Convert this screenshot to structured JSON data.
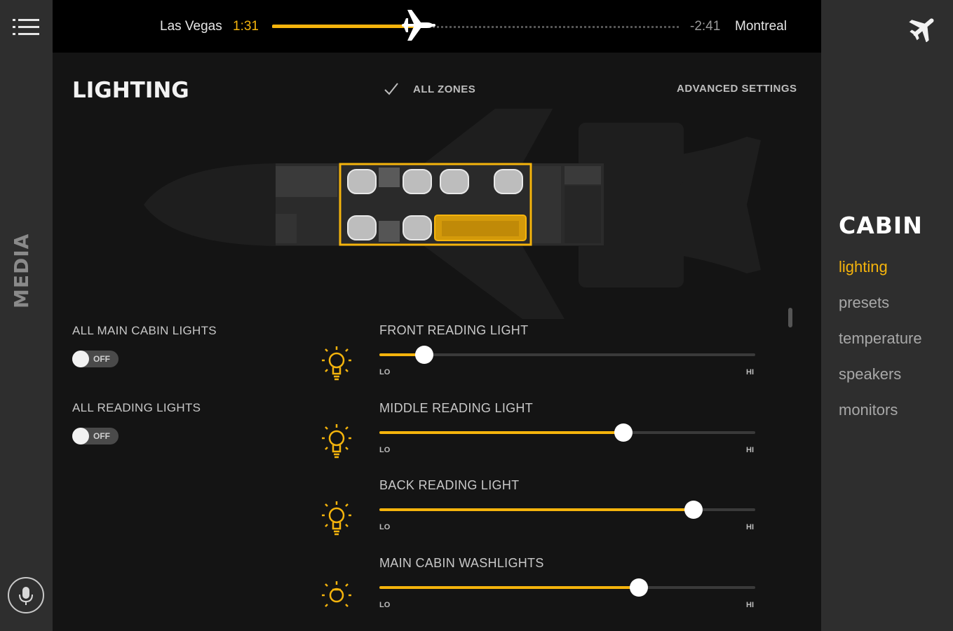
{
  "flight": {
    "origin": "Las Vegas",
    "elapsed": "1:31",
    "remaining": "-2:41",
    "destination": "Montreal",
    "progress": 0.36
  },
  "left_rail": {
    "menu_icon": "hamburger-menu-icon",
    "label": "MEDIA",
    "mic_icon": "microphone-icon"
  },
  "header": {
    "title": "LIGHTING",
    "all_zones_label": "ALL ZONES",
    "all_zones_checked": true,
    "advanced_label": "ADVANCED SETTINGS"
  },
  "toggles": [
    {
      "label": "ALL MAIN CABIN LIGHTS",
      "state": "OFF"
    },
    {
      "label": "ALL READING LIGHTS",
      "state": "OFF"
    }
  ],
  "sliders": [
    {
      "label": "FRONT READING LIGHT",
      "level": 0.12,
      "lo": "LO",
      "hi": "HI"
    },
    {
      "label": "MIDDLE READING LIGHT",
      "level": 0.65,
      "lo": "LO",
      "hi": "HI"
    },
    {
      "label": "BACK READING LIGHT",
      "level": 0.835,
      "lo": "LO",
      "hi": "HI"
    },
    {
      "label": "MAIN CABIN WASHLIGHTS",
      "level": 0.69,
      "lo": "LO",
      "hi": "HI"
    }
  ],
  "right_panel": {
    "flight_icon": "airplane-icon",
    "title": "CABIN",
    "nav": [
      {
        "label": "lighting",
        "active": true
      },
      {
        "label": "presets",
        "active": false
      },
      {
        "label": "temperature",
        "active": false
      },
      {
        "label": "speakers",
        "active": false
      },
      {
        "label": "monitors",
        "active": false
      }
    ]
  },
  "colors": {
    "accent": "#f5b40c",
    "background": "#141414",
    "rail": "#2e2e2e"
  }
}
